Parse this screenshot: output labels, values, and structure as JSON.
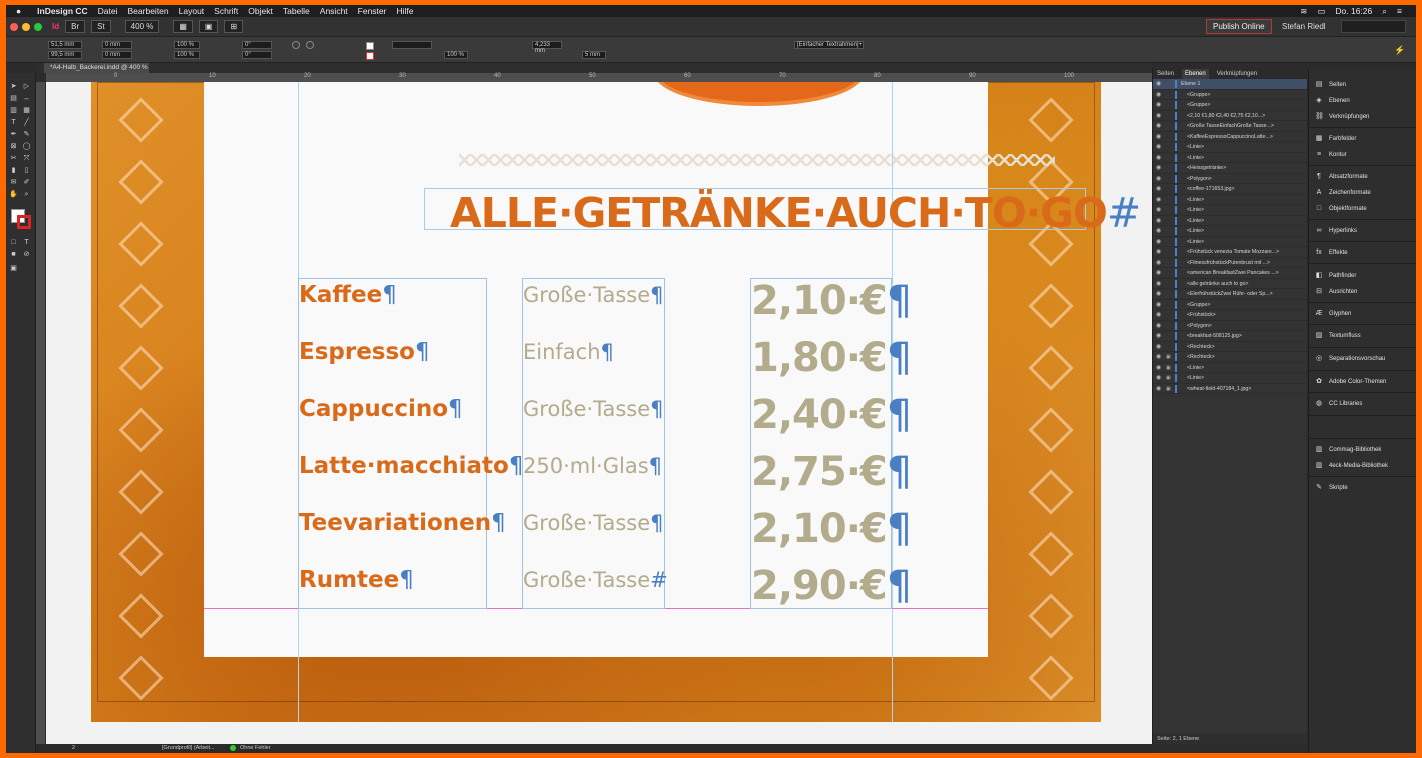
{
  "menubar": {
    "app_name": "InDesign CC",
    "items": [
      "Datei",
      "Bearbeiten",
      "Layout",
      "Schrift",
      "Objekt",
      "Tabelle",
      "Ansicht",
      "Fenster",
      "Hilfe"
    ],
    "clock": "Do. 16:26"
  },
  "appbar": {
    "zoom": "400 %",
    "br_label": "Br",
    "st_label": "St",
    "publish_label": "Publish Online",
    "user": "Stefan Riedl"
  },
  "control": {
    "x_value": "51,5 mm",
    "y_value": "99,5 mm",
    "w_value": "0 mm",
    "h_value": "0 mm",
    "scale_x": "100 %",
    "scale_y": "100 %",
    "rotate": "0°",
    "shear": "0°",
    "stroke_pct": "100 %",
    "gap_value": "4,233 mm",
    "col_gap": "5 mm",
    "frame_style": "[Einfacher Textrahmen]+"
  },
  "document": {
    "tab_title": "*A4-Halb_Backerei.indd @ 400 %",
    "ruler_ticks": [
      "0",
      "10",
      "20",
      "30",
      "40",
      "50",
      "60",
      "70",
      "80",
      "90",
      "100"
    ]
  },
  "menu_card": {
    "headline": "ALLE·GETRÄNKE·AUCH·TO·GO",
    "headline_end": "#",
    "pilcrow": "¶",
    "hash": "#",
    "rows": [
      {
        "name": "Kaffee",
        "desc": "Große·Tasse",
        "price": "2,10·€"
      },
      {
        "name": "Espresso",
        "desc": "Einfach",
        "price": "1,80·€"
      },
      {
        "name": "Cappuccino",
        "desc": "Große·Tasse",
        "price": "2,40·€"
      },
      {
        "name": "Latte·macchiato",
        "desc": "250·ml·Glas",
        "price": "2,75·€"
      },
      {
        "name": "Teevariationen",
        "desc": "Große·Tasse",
        "price": "2,10·€"
      },
      {
        "name": "Rumtee",
        "desc": "Große·Tasse",
        "price": "2,90·€"
      }
    ]
  },
  "layers_panel": {
    "tabs": [
      "Seiten",
      "Ebenen",
      "Verknüpfungen"
    ],
    "active_tab": "Ebenen",
    "layer_name": "Ebene 1",
    "items": [
      "<Gruppe>",
      "<Gruppe>",
      "<2,10 €1,80 €2,40 €2,75 €2,10...>",
      "<Große TasseEinfachGroße Tasse...>",
      "<KaffeeEspressoCappuccinoLatte...>",
      "<Linie>",
      "<Linie>",
      "<Heissgetränke>",
      "<Polygon>",
      "<coffee-171653.jpg>",
      "<Linie>",
      "<Linie>",
      "<Linie>",
      "<Linie>",
      "<Linie>",
      "<Frühstück venezia Tomate Mozzare...>",
      "<FitnessfrühstückPutenbrust mit ...>",
      "<american BreakfastZwei Pancakes ...>",
      "<alle getränke auch to go>",
      "<ElerfrühstückZwei Rühr- oder Sp...>",
      "<Gruppe>",
      "<Frühstück>",
      "<Polygon>",
      "<breakfast-508125.jpg>",
      "<Rechteck>",
      "<Rechteck>",
      "<Linie>",
      "<Linie>",
      "<wheat-field-407184_1.jpg>"
    ],
    "footer": "Seite: 2, 1 Ebene"
  },
  "side_panels": {
    "items": [
      {
        "label": "Seiten",
        "icon": "pages-icon"
      },
      {
        "label": "Ebenen",
        "icon": "layers-icon"
      },
      {
        "label": "Verknüpfungen",
        "icon": "links-icon"
      },
      {
        "label": "Farbfelder",
        "icon": "swatches-icon"
      },
      {
        "label": "Kontur",
        "icon": "stroke-icon"
      },
      {
        "label": "Absatzformate",
        "icon": "paragraph-styles-icon"
      },
      {
        "label": "Zeichenformate",
        "icon": "character-styles-icon"
      },
      {
        "label": "Objektformate",
        "icon": "object-styles-icon"
      },
      {
        "label": "Hyperlinks",
        "icon": "hyperlinks-icon"
      },
      {
        "label": "Effekte",
        "icon": "effects-icon"
      },
      {
        "label": "Pathfinder",
        "icon": "pathfinder-icon"
      },
      {
        "label": "Ausrichten",
        "icon": "align-icon"
      },
      {
        "label": "Glyphen",
        "icon": "glyphs-icon"
      },
      {
        "label": "Textumfluss",
        "icon": "text-wrap-icon"
      },
      {
        "label": "Separationsvorschau",
        "icon": "separations-icon"
      },
      {
        "label": "Adobe Color-Themen",
        "icon": "color-themes-icon"
      },
      {
        "label": "CC Libraries",
        "icon": "cc-libraries-icon"
      },
      {
        "label": "Commag-Bibliothek",
        "icon": "library-icon"
      },
      {
        "label": "4eck-Media-Bibliothek",
        "icon": "library-icon"
      },
      {
        "label": "Skripte",
        "icon": "scripts-icon"
      }
    ]
  },
  "statusbar": {
    "page": "2",
    "profile": "[Grundprofil] (Arbeit...",
    "errors": "Ohne Fehler"
  }
}
